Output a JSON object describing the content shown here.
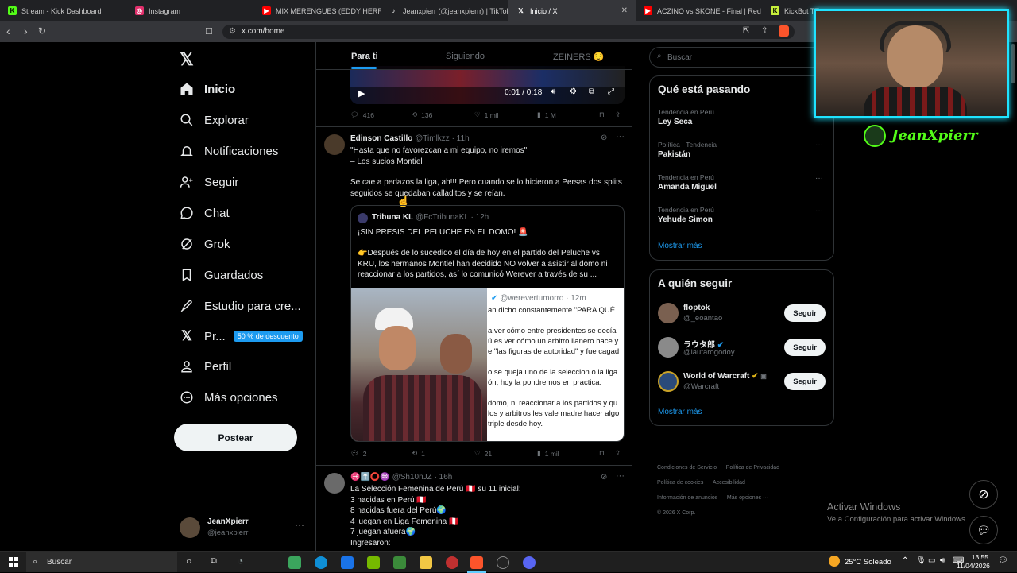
{
  "browser": {
    "tabs": [
      {
        "label": "Stream - Kick Dashboard",
        "color": "#53fc18",
        "glyph": "K"
      },
      {
        "label": "Instagram",
        "color": "#e1306c",
        "glyph": "◎"
      },
      {
        "label": "MIX MERENGUES (EDDY HERRE",
        "color": "#ff0000",
        "glyph": "▶"
      },
      {
        "label": "Jeanxpierr (@jeanxpierrr) | TikTok",
        "color": "#ffffff",
        "glyph": "♪"
      },
      {
        "label": "Inicio / X",
        "color": "#ffffff",
        "glyph": "X"
      },
      {
        "label": "ACZINO vs SKONE - Final | Red Bull",
        "color": "#ff0000",
        "glyph": "▶"
      },
      {
        "label": "KickBot TT",
        "color": "#c7f03c",
        "glyph": "K"
      }
    ],
    "url": "x.com/home"
  },
  "nav": {
    "items": [
      {
        "label": "Inicio"
      },
      {
        "label": "Explorar"
      },
      {
        "label": "Notificaciones"
      },
      {
        "label": "Seguir"
      },
      {
        "label": "Chat"
      },
      {
        "label": "Grok"
      },
      {
        "label": "Guardados"
      },
      {
        "label": "Estudio para cre..."
      },
      {
        "label": "Pr..."
      },
      {
        "label": "Perfil"
      },
      {
        "label": "Más opciones"
      }
    ],
    "premium_badge": "50 % de descuento",
    "post_button": "Postear",
    "account": {
      "name": "JeanXpierr",
      "handle": "@jeanxpierr"
    }
  },
  "timeline": {
    "tabs": [
      "Para ti",
      "Siguiendo",
      "ZEINERS 😌"
    ],
    "video": {
      "time": "0:01 / 0:18"
    },
    "tweet0_actions": {
      "replies": "416",
      "reposts": "136",
      "likes": "1 mil",
      "views": "1 M"
    },
    "tweet1": {
      "name": "Edinson Castillo",
      "handle": "@Timlkzz",
      "time": "· 11h",
      "line1": "\"Hasta que no favorezcan a mi equipo, no iremos\"",
      "line2": "– Los sucios Montiel",
      "line3": "Se cae a pedazos la liga, ah!!! Pero cuando se lo hicieron a Persas dos splits seguidos se quedaban calladitos y se reían.",
      "quote": {
        "name": "Tribuna KL",
        "handle": "@FcTribunaKL",
        "time": "· 12h",
        "headline": "¡SIN PRESIS DEL PELUCHE EN EL DOMO! 🚨",
        "body": "👉Después de lo sucedido el día de hoy en el partido del Peluche vs KRU, los hermanos Montiel han decidido NO volver a asistir al domo ni reaccionar a los partidos, así lo comunicó Werever a través de su ...",
        "inner_handle": "@werevertumorro",
        "inner_time": "· 12m",
        "inner_lines": [
          "an dicho constantemente \"PARA QUÉ",
          "a ver cómo entre presidentes se decía",
          "ú es ver cómo un arbitro llanero hace y",
          "e \"las figuras de autoridad\" y fue cagad",
          "o se queja uno de la seleccion o la liga",
          "ón, hoy la pondremos en practica.",
          "domo, ni reaccionar a los partidos y qu",
          "los y arbitros les vale madre hacer algo",
          "triple desde hoy."
        ]
      },
      "actions": {
        "replies": "2",
        "reposts": "1",
        "likes": "21",
        "views": "1 mil"
      }
    },
    "tweet2": {
      "name": "♓⬆️⭕♒",
      "handle": "@Sh10nJZ",
      "time": "· 16h",
      "lines": [
        "La Selección Femenina de Perú 🇵🇪 su 11 inicial:",
        "3 nacidas en Perú 🇵🇪",
        "8 nacidas fuera del Perú🌍",
        "4 juegan en Liga Femenina 🇵🇪",
        "7 juegan afuera🌍",
        "Ingresaron:"
      ]
    }
  },
  "sidebar": {
    "search_placeholder": "Buscar",
    "trends_title": "Qué está pasando",
    "trends": [
      {
        "meta": "Tendencia en Perú",
        "name": "Ley Seca"
      },
      {
        "meta": "Política · Tendencia",
        "name": "Pakistán"
      },
      {
        "meta": "Tendencia en Perú",
        "name": "Amanda Miguel"
      },
      {
        "meta": "Tendencia en Perú",
        "name": "Yehude Simon"
      }
    ],
    "show_more": "Mostrar más",
    "follow_title": "A quién seguir",
    "follow": [
      {
        "name": "floptok",
        "handle": "@_eoantao",
        "button": "Seguir"
      },
      {
        "name": "ラウタ郎",
        "handle": "@lautarogodoy",
        "button": "Seguir"
      },
      {
        "name": "World of Warcraft",
        "handle": "@Warcraft",
        "button": "Seguir"
      }
    ],
    "show_more2": "Mostrar más",
    "footer": [
      "Condiciones de Servicio",
      "Política de Privacidad",
      "Política de cookies",
      "Accesibilidad",
      "Información de anuncios",
      "Más opciones ···",
      "© 2026 X Corp."
    ]
  },
  "overlay": {
    "streamer": "JeanXpierr",
    "activate_title": "Activar Windows",
    "activate_sub": "Ve a Configuración para activar Windows."
  },
  "taskbar": {
    "search": "Buscar",
    "weather": "25°C  Soleado",
    "time": "13:55",
    "date": "11/04/2026"
  }
}
